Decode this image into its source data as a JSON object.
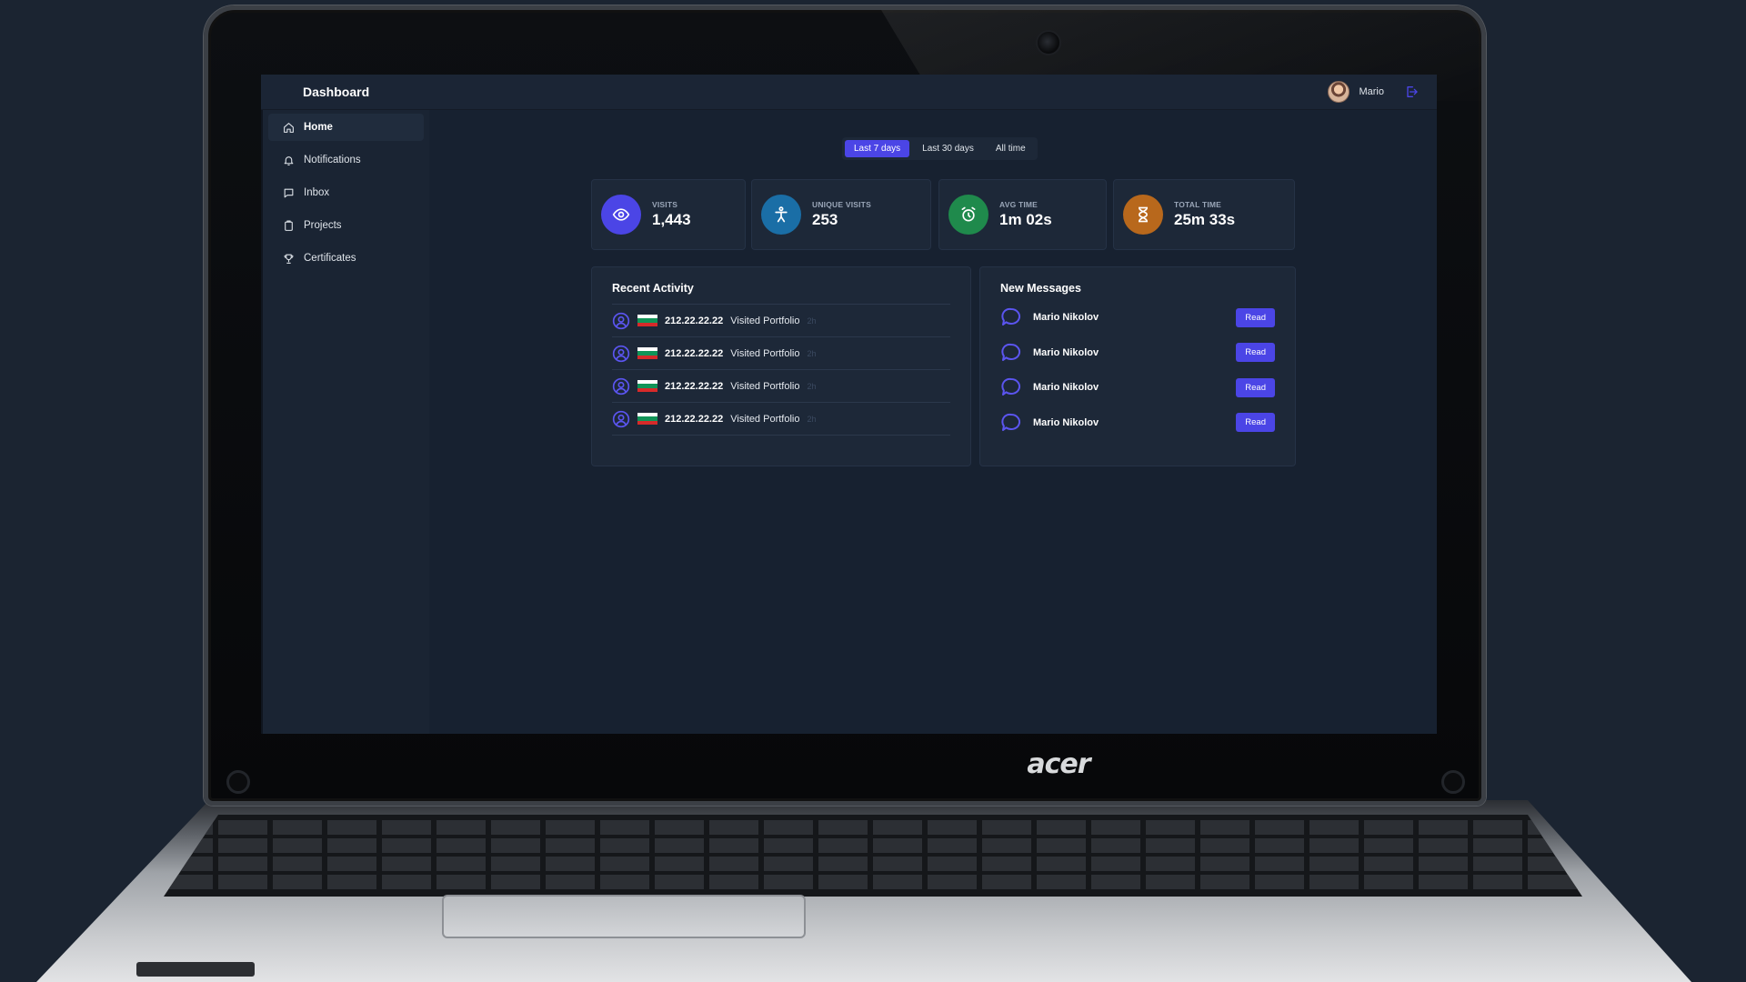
{
  "app": {
    "title": "Dashboard",
    "user_name": "Mario"
  },
  "sidebar": {
    "items": [
      {
        "label": "Home",
        "icon": "home-icon",
        "active": true
      },
      {
        "label": "Notifications",
        "icon": "bell-icon",
        "active": false
      },
      {
        "label": "Inbox",
        "icon": "chat-icon",
        "active": false
      },
      {
        "label": "Projects",
        "icon": "clipboard-icon",
        "active": false
      },
      {
        "label": "Certificates",
        "icon": "trophy-icon",
        "active": false
      }
    ]
  },
  "range_tabs": [
    {
      "label": "Last 7 days",
      "active": true
    },
    {
      "label": "Last 30 days",
      "active": false
    },
    {
      "label": "All time",
      "active": false
    }
  ],
  "stats": [
    {
      "label": "VISITS",
      "value": "1,443",
      "icon": "eye-icon",
      "color": "#4b45e6"
    },
    {
      "label": "UNIQUE VISITS",
      "value": "253",
      "icon": "person-icon",
      "color": "#1a6ea6"
    },
    {
      "label": "AVG TIME",
      "value": "1m 02s",
      "icon": "alarm-clock-icon",
      "color": "#1f8a4c"
    },
    {
      "label": "TOTAL TIME",
      "value": "25m 33s",
      "icon": "hourglass-icon",
      "color": "#b8681c"
    }
  ],
  "recent_activity": {
    "title": "Recent Activity",
    "rows": [
      {
        "ip": "212.22.22.22",
        "action": "Visited Portfolio",
        "ago": "2h",
        "flag": "bulgaria-flag"
      },
      {
        "ip": "212.22.22.22",
        "action": "Visited Portfolio",
        "ago": "2h",
        "flag": "bulgaria-flag"
      },
      {
        "ip": "212.22.22.22",
        "action": "Visited Portfolio",
        "ago": "2h",
        "flag": "bulgaria-flag"
      },
      {
        "ip": "212.22.22.22",
        "action": "Visited Portfolio",
        "ago": "2h",
        "flag": "bulgaria-flag"
      }
    ]
  },
  "new_messages": {
    "title": "New Messages",
    "rows": [
      {
        "name": "Mario Nikolov",
        "button": "Read"
      },
      {
        "name": "Mario Nikolov",
        "button": "Read"
      },
      {
        "name": "Mario Nikolov",
        "button": "Read"
      },
      {
        "name": "Mario Nikolov",
        "button": "Read"
      }
    ]
  },
  "device": {
    "brand": "acer"
  },
  "colors": {
    "accent": "#4b45e6",
    "background": "#172130",
    "card": "#1d2838"
  }
}
